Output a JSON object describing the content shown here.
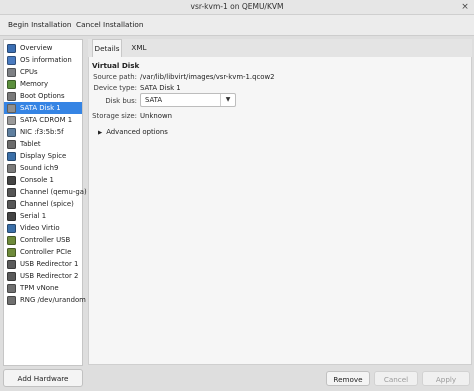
{
  "window": {
    "title": "vsr-kvm-1 on QEMU/KVM",
    "close_glyph": "×"
  },
  "toolbar": {
    "begin_install": "Begin Installation",
    "cancel_install": "Cancel Installation"
  },
  "sidebar": {
    "items": [
      {
        "label": "Overview",
        "icon": "monitor-icon",
        "color": "#3c6fb3"
      },
      {
        "label": "OS information",
        "icon": "os-info-icon",
        "color": "#4a7bc0"
      },
      {
        "label": "CPUs",
        "icon": "cpu-icon",
        "color": "#7d8084"
      },
      {
        "label": "Memory",
        "icon": "memory-icon",
        "color": "#5b8f3c"
      },
      {
        "label": "Boot Options",
        "icon": "boot-icon",
        "color": "#7a7a7a"
      },
      {
        "label": "SATA Disk 1",
        "icon": "disk-icon",
        "color": "#8f8f8f",
        "selected": true
      },
      {
        "label": "SATA CDROM 1",
        "icon": "cdrom-icon",
        "color": "#9a9a9a"
      },
      {
        "label": "NIC :f3:5b:5f",
        "icon": "nic-icon",
        "color": "#5f7f9f"
      },
      {
        "label": "Tablet",
        "icon": "tablet-icon",
        "color": "#6b6b6b"
      },
      {
        "label": "Display Spice",
        "icon": "display-icon",
        "color": "#3b6fa8"
      },
      {
        "label": "Sound ich9",
        "icon": "sound-icon",
        "color": "#7a7a7a"
      },
      {
        "label": "Console 1",
        "icon": "console-icon",
        "color": "#444444"
      },
      {
        "label": "Channel (qemu-ga)",
        "icon": "channel-icon",
        "color": "#555555"
      },
      {
        "label": "Channel (spice)",
        "icon": "channel-icon",
        "color": "#555555"
      },
      {
        "label": "Serial 1",
        "icon": "serial-icon",
        "color": "#444444"
      },
      {
        "label": "Video Virtio",
        "icon": "video-icon",
        "color": "#3b6fa8"
      },
      {
        "label": "Controller USB",
        "icon": "controller-icon",
        "color": "#6d8a3a"
      },
      {
        "label": "Controller PCIe",
        "icon": "controller-icon",
        "color": "#6d8a3a"
      },
      {
        "label": "USB Redirector 1",
        "icon": "usb-icon",
        "color": "#5a5a5a"
      },
      {
        "label": "USB Redirector 2",
        "icon": "usb-icon",
        "color": "#5a5a5a"
      },
      {
        "label": "TPM vNone",
        "icon": "tpm-icon",
        "color": "#6f6f6f"
      },
      {
        "label": "RNG /dev/urandom",
        "icon": "rng-icon",
        "color": "#6f6f6f"
      }
    ],
    "add_hardware": "Add Hardware"
  },
  "tabs": [
    {
      "label": "Details",
      "active": true
    },
    {
      "label": "XML",
      "active": false
    }
  ],
  "details": {
    "section_title": "Virtual Disk",
    "source_path_label": "Source path:",
    "source_path": "/var/lib/libvirt/images/vsr-kvm-1.qcow2",
    "device_type_label": "Device type:",
    "device_type": "SATA Disk 1",
    "disk_bus_label": "Disk bus:",
    "disk_bus": "SATA",
    "storage_size_label": "Storage size:",
    "storage_size": "Unknown",
    "advanced_label": "Advanced options",
    "dropdown_glyph": "▼",
    "expander_glyph": "▶"
  },
  "buttons": {
    "remove": "Remove",
    "cancel": "Cancel",
    "apply": "Apply"
  },
  "colors": {
    "selection": "#3584e4"
  }
}
